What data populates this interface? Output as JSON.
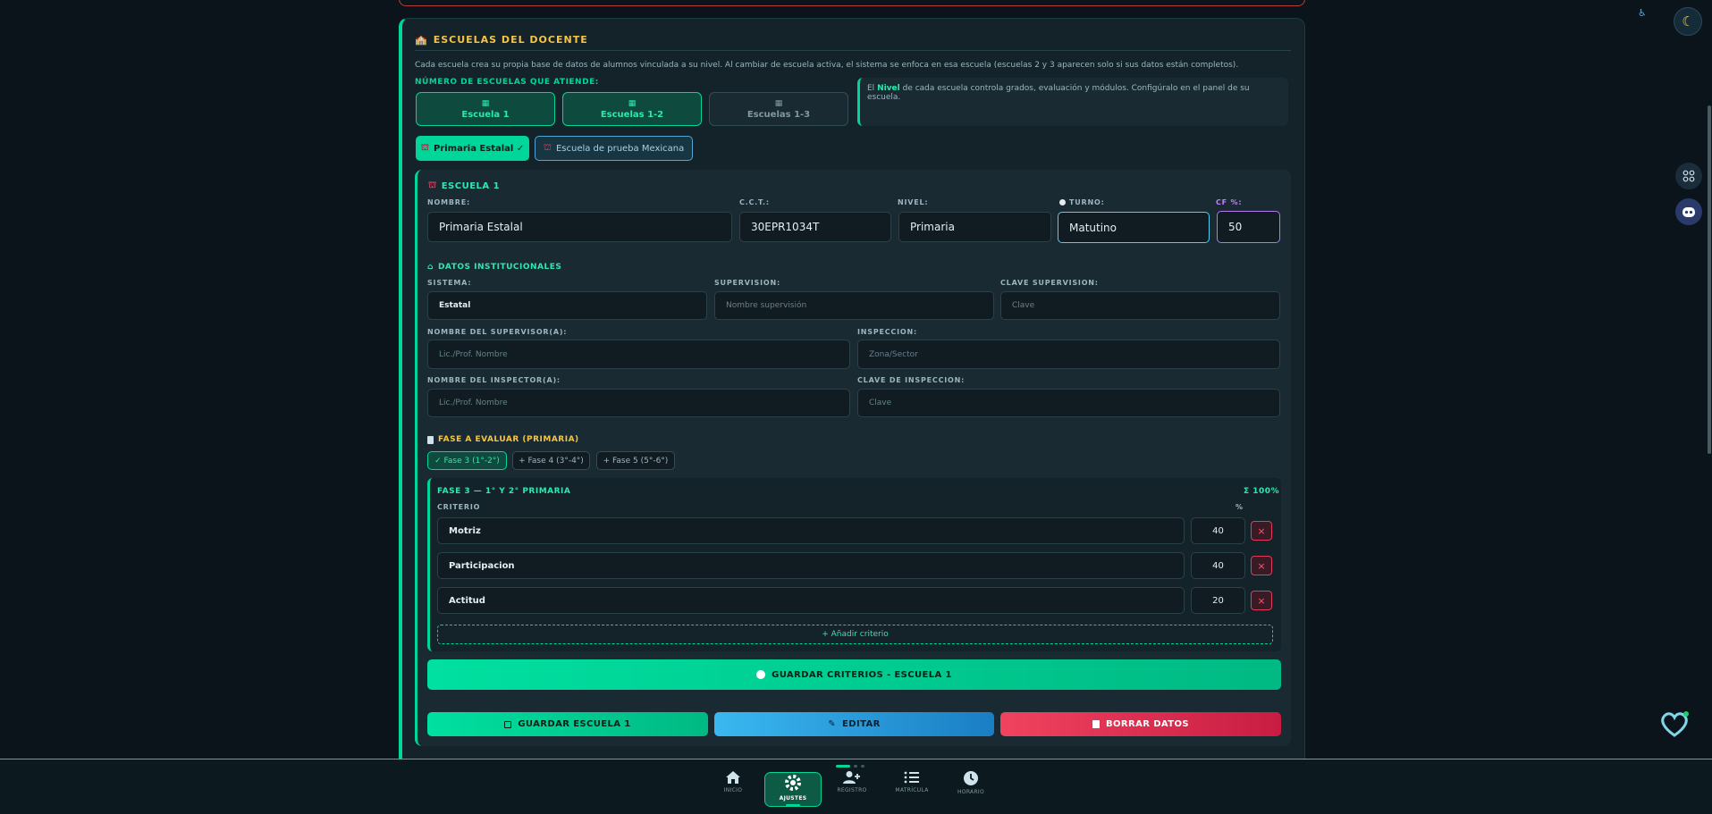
{
  "section": {
    "title": "ESCUELAS DEL DOCENTE",
    "description": "Cada escuela crea su propia base de datos de alumnos vinculada a su nivel. Al cambiar de escuela activa, el sistema se enfoca en esa escuela (escuelas 2 y 3 aparecen solo si sus datos están completos).",
    "num_label": "NÚMERO DE ESCUELAS QUE ATIENDE:",
    "options": [
      "Escuela 1",
      "Escuelas 1-2",
      "Escuelas 1-3"
    ],
    "info_pre": "El ",
    "info_bold": "Nivel",
    "info_post": " de cada escuela controla grados, evaluación y módulos. Configúralo en el panel de su escuela."
  },
  "school_tabs": {
    "active": "Primaria Estalal ✓",
    "other": "Escuela de prueba Mexicana"
  },
  "school": {
    "heading": "ESCUELA 1",
    "labels": {
      "nombre": "NOMBRE:",
      "cct": "C.C.T.:",
      "nivel": "NIVEL:",
      "turno": "TURNO:",
      "cf": "CF %:"
    },
    "values": {
      "nombre": "Primaria Estalal",
      "cct": "30EPR1034T",
      "nivel": "Primaria",
      "turno": "Matutino",
      "cf": "50"
    }
  },
  "institutional": {
    "heading": "DATOS INSTITUCIONALES",
    "sistema_label": "SISTEMA:",
    "sistema_value": "Estatal",
    "supervision_label": "SUPERVISION:",
    "supervision_ph": "Nombre supervisión",
    "clave_sup_label": "CLAVE SUPERVISION:",
    "clave_sup_ph": "Clave",
    "supervisor_label": "NOMBRE DEL SUPERVISOR(A):",
    "supervisor_ph": "Lic./Prof. Nombre",
    "inspeccion_label": "INSPECCION:",
    "inspeccion_ph": "Zona/Sector",
    "inspector_label": "NOMBRE DEL INSPECTOR(A):",
    "inspector_ph": "Lic./Prof. Nombre",
    "clave_insp_label": "CLAVE DE INSPECCION:",
    "clave_insp_ph": "Clave"
  },
  "fase": {
    "heading": "FASE A EVALUAR (PRIMARIA)",
    "chips": [
      "✓ Fase 3 (1°-2°)",
      "+ Fase 4 (3°-4°)",
      "+ Fase 5 (5°-6°)"
    ],
    "box_title": "FASE 3 — 1° Y 2° PRIMARIA",
    "total": "Σ 100%",
    "col_criterio": "CRITERIO",
    "col_pct": "%",
    "criteria": [
      {
        "name": "Motriz",
        "pct": "40"
      },
      {
        "name": "Participacion",
        "pct": "40"
      },
      {
        "name": "Actitud",
        "pct": "20"
      }
    ],
    "add": "+ Añadir criterio"
  },
  "buttons": {
    "save_criteria": "GUARDAR CRITERIOS - ESCUELA 1",
    "save_school": "GUARDAR ESCUELA 1",
    "edit": "EDITAR",
    "delete": "BORRAR DATOS"
  },
  "nav": [
    "INICIO",
    "AJUSTES",
    "REGISTRO",
    "MATRÍCULA",
    "HORARIO"
  ]
}
